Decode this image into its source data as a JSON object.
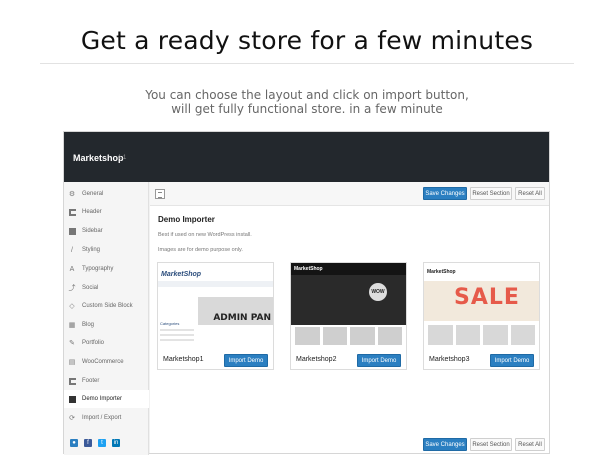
{
  "headline": "Get a ready store for a few minutes",
  "subtitle": [
    "You can choose the layout and click on import button,",
    "will get fully functional store. in a few minute"
  ],
  "topbar": {
    "brand": "Marketshop",
    "version": "1.1"
  },
  "sidebar": {
    "items": [
      {
        "label": "General",
        "icon": "gear-icon"
      },
      {
        "label": "Header",
        "icon": "header-icon"
      },
      {
        "label": "Sidebar",
        "icon": "sidebar-icon"
      },
      {
        "label": "Styling",
        "icon": "brush-icon"
      },
      {
        "label": "Typography",
        "icon": "font-icon"
      },
      {
        "label": "Social",
        "icon": "share-icon"
      },
      {
        "label": "Custom Side Block",
        "icon": "code-icon"
      },
      {
        "label": "Blog",
        "icon": "grid-icon"
      },
      {
        "label": "Portfolio",
        "icon": "briefcase-icon"
      },
      {
        "label": "WooCommerce",
        "icon": "cart-icon"
      },
      {
        "label": "Footer",
        "icon": "footer-icon"
      },
      {
        "label": "Demo Importer",
        "icon": "import-icon"
      },
      {
        "label": "Import / Export",
        "icon": "refresh-icon"
      }
    ],
    "active": "Demo Importer"
  },
  "toolbar": {
    "save": "Save Changes",
    "reset_section": "Reset Section",
    "reset_all": "Reset All"
  },
  "section": {
    "title": "Demo Importer",
    "desc1": "Best if used on new WordPress install.",
    "desc2": "Images are for demo purpose only."
  },
  "demos": [
    {
      "name": "Marketshop1",
      "button": "Import Demo",
      "thumb_logo": "MarketShop",
      "thumb_banner": "ADMIN PAN",
      "thumb_cat": "Categories"
    },
    {
      "name": "Marketshop2",
      "button": "Import Demo",
      "thumb_logo": "MarketShop",
      "thumb_badge": "WOW"
    },
    {
      "name": "Marketshop3",
      "button": "Import Demo",
      "thumb_logo": "MarketShop",
      "thumb_sale": "SALE"
    }
  ],
  "colors": {
    "primary": "#2b7fc1",
    "topbar": "#23282d"
  }
}
